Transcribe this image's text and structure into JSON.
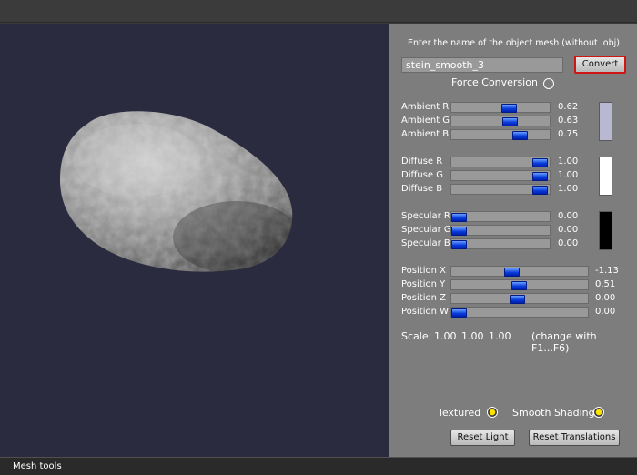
{
  "viewport": {
    "object": "textured-rock-mesh"
  },
  "panel": {
    "prompt": "Enter the name of the object mesh (without .obj)",
    "mesh_name": "stein_smooth_3",
    "convert_label": "Convert",
    "force_conversion_label": "Force Conversion",
    "force_conversion_checked": false,
    "ambient": [
      {
        "label": "Ambient R",
        "value": "0.62",
        "level": 0.62
      },
      {
        "label": "Ambient G",
        "value": "0.63",
        "level": 0.63
      },
      {
        "label": "Ambient B",
        "value": "0.75",
        "level": 0.75
      }
    ],
    "ambient_color": "#b8b8d2",
    "diffuse": [
      {
        "label": "Diffuse R",
        "value": "1.00",
        "level": 1.0
      },
      {
        "label": "Diffuse G",
        "value": "1.00",
        "level": 1.0
      },
      {
        "label": "Diffuse B",
        "value": "1.00",
        "level": 1.0
      }
    ],
    "diffuse_color": "#ffffff",
    "specular": [
      {
        "label": "Specular R",
        "value": "0.00",
        "level": 0.0
      },
      {
        "label": "Specular G",
        "value": "0.00",
        "level": 0.0
      },
      {
        "label": "Specular B",
        "value": "0.00",
        "level": 0.0
      }
    ],
    "specular_color": "#000000",
    "position": [
      {
        "label": "Position X",
        "value": "-1.13",
        "level": 0.44
      },
      {
        "label": "Position Y",
        "value": "0.51",
        "level": 0.5
      },
      {
        "label": "Position Z",
        "value": "0.00",
        "level": 0.49
      },
      {
        "label": "Position W",
        "value": "0.00",
        "level": 0.0
      }
    ],
    "scale_label": "Scale:",
    "scale_values": [
      "1.00",
      "1.00",
      "1.00"
    ],
    "scale_hint": "(change with F1...F6)",
    "textured_label": "Textured",
    "textured_checked": true,
    "smooth_label": "Smooth Shading",
    "smooth_checked": true,
    "reset_light_label": "Reset Light",
    "reset_translations_label": "Reset Translations"
  },
  "statusbar": {
    "title": "Mesh tools"
  },
  "colors": {
    "slider_thumb": "#1e50f0",
    "convert_border": "#d01515",
    "radio_on": "#ffe400"
  }
}
